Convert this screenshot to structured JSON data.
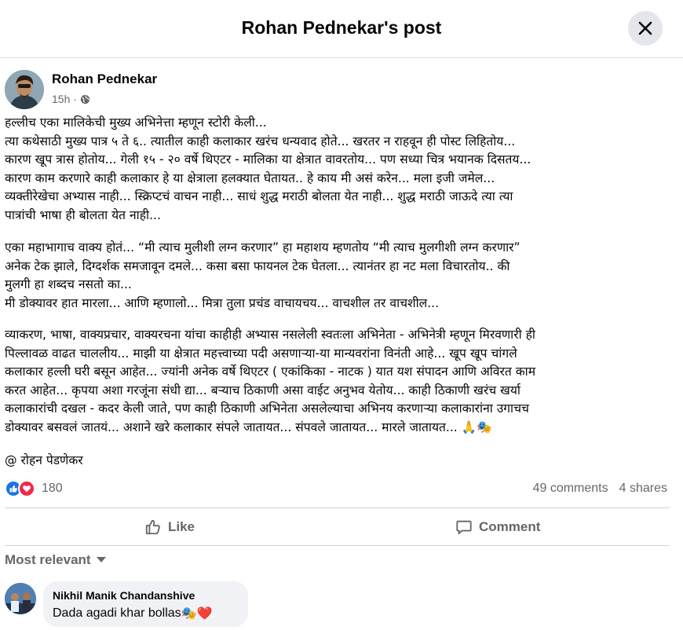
{
  "header": {
    "title": "Rohan Pednekar's post"
  },
  "post": {
    "author": "Rohan Pednekar",
    "time": "15h",
    "time_separator": "·",
    "paragraphs": [
      [
        "हल्लीच एका मालिकेची मुख्य अभिनेत्ता म्हणून स्टोरी केली...",
        "त्या कथेसाठी मुख्य पात्र ५ ते ६.. त्यातील काही कलाकार खरंच धन्यवाद होते... खरतर न राहवून ही पोस्ट लिहितोय...",
        "कारण खूप त्रास होतोय... गेली १५ - २० वर्षे थिएटर - मालिका या क्षेत्रात वावरतोय... पण सध्या चित्र भयानक दिसतय...",
        "कारण काम करणारे काही कलाकार हे या क्षेत्राला हलक्यात घेतायत.. हे काय मी असं करेन... मला इजी जमेल...",
        "व्यक्तीरेखेचा अभ्यास नाही... स्क्रिप्टचं वाचन नाही... साधं शुद्ध मराठी बोलता येत नाही... शुद्ध मराठी जाऊदे त्या त्या",
        "पात्रांची भाषा ही बोलता येत नाही..."
      ],
      [
        "एका महाभागाच वाक्य होतं... “मी त्याच मुलीशी लग्न करणार” हा महाशय म्हणतोय “मी त्याच मुलगीशी लग्न करणार”",
        "अनेक टेक झाले, दिग्दर्शक समजावून दमले... कसा बसा फायनल टेक घेतला... त्यानंतर हा नट मला विचारतोय.. की",
        "मुलगी हा शब्दच नसतो का...",
        "मी डोक्यावर हात मारला... आणि म्हणालो... मित्रा तुला प्रचंड वाचायचय... वाचशील तर वाचशील..."
      ],
      [
        "व्याकरण, भाषा, वाक्यप्रचार, वाक्यरचना यांचा काहीही अभ्यास नसलेली स्वतःला अभिनेता - अभिनेत्री म्हणून मिरवणारी ही",
        "पिल्लावळ वाढत चाललीय... माझी या क्षेत्रात महत्त्वाच्या पदी असणाऱ्या-या  मान्यवरांना विनंती आहे... खूप खूप चांगले",
        "कलाकार हल्ली घरी बसून आहेत... ज्यांनी अनेक वर्षे थिएटर ( एकांकिका - नाटक ) यात यश संपादन आणि अविरत काम",
        "करत आहेत... कृपया अशा गरजूंना संधी द्या... बऱ्याच ठिकाणी असा वाईट अनुभव येतोय... काही ठिकाणी खरंच खर्या",
        "कलाकारांची दखल - कदर केली जाते, पण काही ठिकाणी अभिनेता असलेल्याचा अभिनय करणाऱ्या कलाकारांना उगाचच",
        "डोक्यावर बसवलं जातयं... अशाने खरे कलाकार संपले जातायत... संपवले जातायत... मारले जातायत... 🙏🎭"
      ],
      [
        "@ रोहन पेडणेकर"
      ]
    ]
  },
  "stats": {
    "reaction_count": "180",
    "comments": "49 comments",
    "shares": "4 shares"
  },
  "actions": {
    "like": "Like",
    "comment": "Comment"
  },
  "comments_section": {
    "sort_label": "Most relevant",
    "comments": [
      {
        "name": "Nikhil Manik Chandanshive",
        "text": "Dada agadi khar bollas",
        "emoji": "🎭❤️"
      }
    ]
  },
  "icons": {
    "close": "close-icon",
    "globe": "globe-icon",
    "like": "like-icon",
    "comment": "comment-icon",
    "sort": "chevron-down-icon"
  },
  "colors": {
    "like_blue": "#1b74e4",
    "love_red": "#f0284a",
    "secondary_text": "#65676b",
    "bubble_bg": "#f0f2f5"
  }
}
